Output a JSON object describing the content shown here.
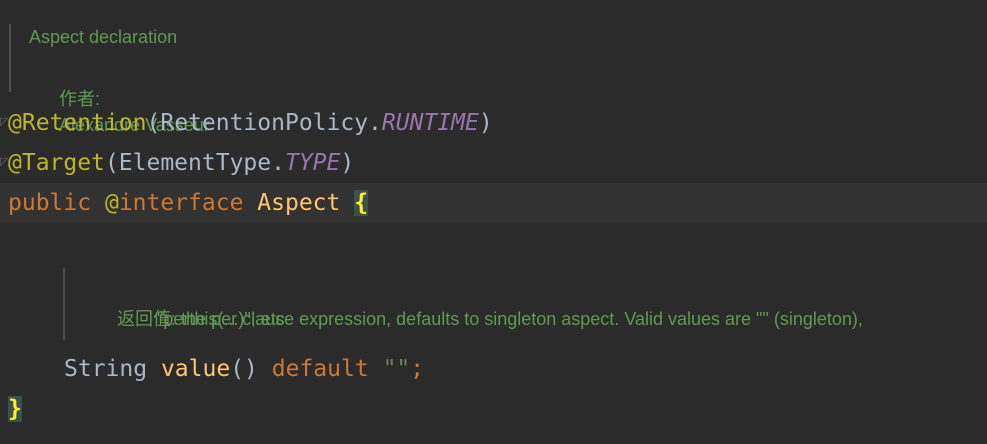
{
  "class_doc": {
    "description": "Aspect declaration",
    "author_label": "作者:",
    "author_name": "Alexandre Vasseur"
  },
  "code": {
    "retention": {
      "annotation": "@Retention",
      "open": "(",
      "policy_class": "RetentionPolicy.",
      "policy_value": "RUNTIME",
      "close": ")"
    },
    "target": {
      "annotation": "@Target",
      "open": "(",
      "type_class": "ElementType.",
      "type_value": "TYPE",
      "close": ")"
    },
    "declaration": {
      "modifier": "public",
      "at_sign": "@",
      "interface_kw": "interface",
      "name": "Aspect",
      "open_brace": "{"
    },
    "method": {
      "return_type": "String",
      "name": "value",
      "parens": "()",
      "default_kw": "default",
      "default_value": "\"\"",
      "semicolon": ";"
    },
    "close_brace": "}"
  },
  "method_doc": {
    "returns_label": "返回值:",
    "returns_text_line1": "the per clause expression, defaults to singleton aspect. Valid values are \"\" (singleton),",
    "returns_text_line2": "\"perthis(...)\", etc"
  },
  "colors": {
    "background": "#2b2b2b",
    "doc_comment": "#629755",
    "annotation": "#bbb529",
    "keyword": "#cc7832",
    "method_name": "#ffc66d",
    "constant": "#9876aa",
    "plain": "#a9b7c6",
    "brace_highlight": "#ffef28"
  }
}
